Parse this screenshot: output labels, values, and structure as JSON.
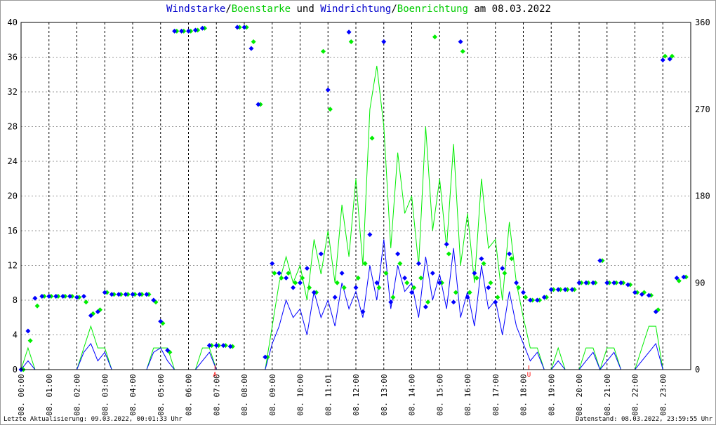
{
  "title": {
    "part1": "Windstarke",
    "sep1": "/",
    "part2": "Boenstarke",
    "mid": " und ",
    "part3": "Windrichtung",
    "sep2": "/",
    "part4": "Boenrichtung",
    "end": " am 08.03.2022"
  },
  "footer": {
    "left": "Letzte Aktualisierung: 09.03.2022, 00:01:33 Uhr",
    "right": "Datenstand: 08.03.2022, 23:59:55 Uhr"
  },
  "colors": {
    "speed": "#0000ff",
    "gust": "#00ee00",
    "grid": "#000000",
    "marker": "#ff0000"
  },
  "chart_data": {
    "type": "line",
    "title": "Windstarke/Boenstarke und Windrichtung/Boenrichtung am 08.03.2022",
    "x_unit": "hours (15 min steps)",
    "xlim": [
      0,
      24
    ],
    "ylim_left": [
      0,
      40
    ],
    "ylim_right": [
      0,
      360
    ],
    "yticks_left": [
      "0",
      "4",
      "8",
      "12",
      "16",
      "20",
      "24",
      "28",
      "32",
      "36",
      "40"
    ],
    "yticks_right": [
      "0",
      "90",
      "180",
      "270",
      "360"
    ],
    "xticks": [
      "08. 00:00",
      "08. 01:00",
      "08. 02:00",
      "08. 03:00",
      "08. 04:00",
      "08. 05:00",
      "08. 06:00",
      "08. 07:00",
      "08. 08:00",
      "08. 09:00",
      "08. 10:00",
      "08. 11:01",
      "08. 12:00",
      "08. 13:00",
      "08. 14:00",
      "08. 15:00",
      "08. 16:00",
      "08. 17:00",
      "08. 18:00",
      "08. 19:00",
      "08. 20:00",
      "08. 21:00",
      "08. 22:00",
      "08. 23:00"
    ],
    "markers": [
      {
        "label": "A",
        "hour": 6.95
      },
      {
        "label": "U",
        "hour": 18.2
      }
    ],
    "series": [
      {
        "name": "Windstarke",
        "axis": "left",
        "kind": "line",
        "values": [
          0,
          1,
          0,
          0,
          0,
          0,
          0,
          0,
          0,
          2,
          3,
          1,
          2,
          0,
          0,
          0,
          0,
          0,
          0,
          2,
          2.5,
          1,
          0,
          0,
          0,
          0,
          1,
          2,
          0,
          0,
          0,
          0,
          0,
          0,
          0,
          0,
          3,
          5,
          8,
          6,
          7,
          4,
          9,
          6,
          8,
          5,
          10,
          7,
          9,
          6,
          12,
          8,
          15,
          7,
          12,
          9,
          10,
          6,
          13,
          8,
          11,
          7,
          14,
          6,
          9,
          5,
          12,
          7,
          8,
          4,
          9,
          5,
          3,
          1,
          2,
          0,
          0,
          1,
          0,
          0,
          0,
          1,
          2,
          0,
          1,
          2,
          0,
          0,
          0,
          1,
          2,
          3,
          0,
          0,
          0,
          0
        ]
      },
      {
        "name": "Boenstarke",
        "axis": "left",
        "kind": "line",
        "values": [
          0,
          2.5,
          0,
          0,
          0,
          0,
          0,
          0,
          0,
          2.5,
          5,
          2.5,
          2.5,
          0,
          0,
          0,
          0,
          0,
          0,
          2.5,
          2.5,
          2.5,
          0,
          0,
          0,
          0,
          2.5,
          2.5,
          0,
          0,
          0,
          0,
          0,
          0,
          0,
          0,
          5,
          10,
          13,
          10,
          12,
          8,
          15,
          11,
          16,
          10,
          19,
          13,
          22,
          12,
          30,
          35,
          28,
          14,
          25,
          18,
          20,
          12,
          28,
          16,
          22,
          14,
          26,
          12,
          18,
          10,
          22,
          14,
          15,
          8,
          17,
          10,
          6,
          2.5,
          2.5,
          0,
          0,
          2.5,
          0,
          0,
          0,
          2.5,
          2.5,
          0,
          2.5,
          2.5,
          0,
          0,
          0,
          2.5,
          5,
          5,
          0,
          0,
          0,
          0
        ]
      },
      {
        "name": "Windrichtung",
        "axis": "right",
        "kind": "points",
        "values": [
          0,
          40,
          74,
          76,
          76,
          76,
          76,
          76,
          75,
          76,
          56,
          60,
          80,
          78,
          78,
          78,
          78,
          78,
          78,
          72,
          50,
          20,
          351,
          351,
          351,
          352,
          354,
          25,
          25,
          25,
          24,
          355,
          355,
          333,
          275,
          13,
          110,
          100,
          95,
          85,
          90,
          105,
          80,
          120,
          290,
          75,
          100,
          350,
          85,
          60,
          140,
          90,
          340,
          70,
          120,
          95,
          80,
          110,
          65,
          100,
          90,
          130,
          70,
          340,
          75,
          100,
          115,
          85,
          70,
          105,
          120,
          90,
          80,
          72,
          72,
          75,
          83,
          83,
          83,
          83,
          90,
          90,
          90,
          113,
          90,
          90,
          90,
          88,
          80,
          78,
          77,
          60,
          321,
          322,
          95,
          96
        ]
      },
      {
        "name": "Boenrichtung",
        "axis": "right",
        "kind": "points",
        "values": [
          0,
          30,
          66,
          76,
          76,
          76,
          76,
          76,
          75,
          70,
          58,
          62,
          80,
          78,
          78,
          78,
          78,
          78,
          78,
          70,
          48,
          18,
          351,
          351,
          351,
          352,
          354,
          25,
          25,
          25,
          24,
          355,
          355,
          340,
          275,
          13,
          100,
          95,
          100,
          90,
          95,
          85,
          80,
          330,
          270,
          90,
          85,
          340,
          95,
          110,
          240,
          85,
          100,
          75,
          110,
          90,
          85,
          95,
          70,
          345,
          90,
          120,
          80,
          330,
          80,
          95,
          110,
          90,
          75,
          100,
          115,
          85,
          75,
          72,
          72,
          75,
          83,
          83,
          83,
          83,
          90,
          90,
          90,
          113,
          90,
          90,
          90,
          88,
          80,
          80,
          77,
          62,
          325,
          325,
          92,
          96
        ]
      }
    ]
  }
}
